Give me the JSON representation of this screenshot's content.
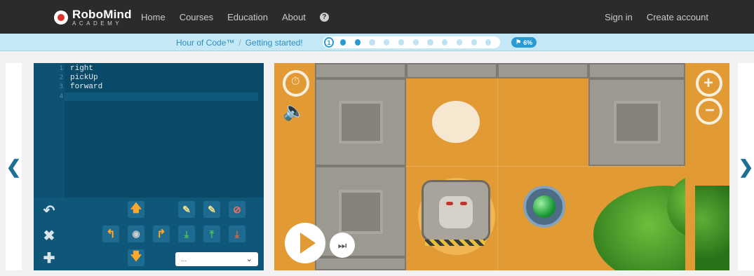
{
  "nav": {
    "logo_main": "RoboMind",
    "logo_sub": "ACADEMY",
    "links": [
      "Home",
      "Courses",
      "Education",
      "About"
    ],
    "help_glyph": "?",
    "sign_in": "Sign in",
    "create_account": "Create account"
  },
  "progress": {
    "crumbs": [
      "Hour of Code™",
      "Getting started!"
    ],
    "current_step": "1",
    "percent": "6%",
    "steps_total": 12,
    "steps_done": 3,
    "accent_color": "#2a9ad3"
  },
  "editor": {
    "lines": [
      {
        "num": "1",
        "text": "right"
      },
      {
        "num": "2",
        "text": "pickUp"
      },
      {
        "num": "3",
        "text": "forward"
      },
      {
        "num": "4",
        "text": ""
      }
    ]
  },
  "palette": {
    "dropdown_value": "..."
  },
  "icons": {
    "prev": "chevron-left-icon",
    "next": "chevron-right-icon",
    "speed": "speed-icon",
    "sound": "sound-icon",
    "zoom_in": "zoom-in-icon",
    "zoom_out": "zoom-out-icon",
    "play": "play-icon",
    "step": "step-icon"
  }
}
